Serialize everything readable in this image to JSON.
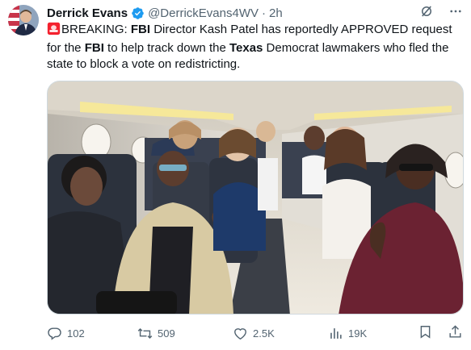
{
  "post": {
    "author_name": "Derrick Evans",
    "handle": "@DerrickEvans4WV",
    "separator": "·",
    "time": "2h",
    "text_parts": {
      "t1": "BREAKING: ",
      "b1": "FBI",
      "t2": " Director Kash Patel has reportedly APPROVED request for the ",
      "b2": "FBI",
      "t3": " to help track down the ",
      "b3": "Texas",
      "t4": " Democrat lawmakers who fled the state to block a vote on redistricting."
    },
    "media_alt_icon": "photo-airplane-cabin"
  },
  "stats": {
    "replies": "102",
    "reposts": "509",
    "likes": "2.5K",
    "views": "19K"
  },
  "colors": {
    "verified": "#1d9bf0",
    "secondary_text": "#536471",
    "siren": "#f4212e"
  }
}
